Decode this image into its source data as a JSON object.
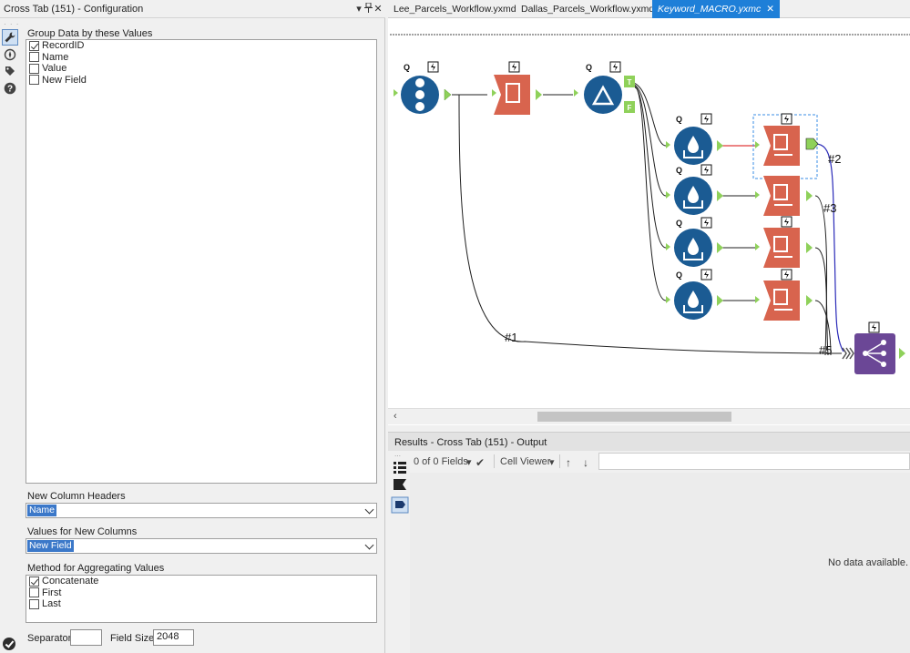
{
  "config_panel": {
    "title": "Cross Tab (151) - Configuration",
    "pin_label": "▾",
    "group_label": "Group Data by these Values",
    "group_fields": [
      {
        "label": "RecordID",
        "checked": true
      },
      {
        "label": "Name",
        "checked": false
      },
      {
        "label": "Value",
        "checked": false
      },
      {
        "label": "New Field",
        "checked": false
      }
    ],
    "headers_label": "New Column Headers",
    "headers_value": "Name",
    "values_label": "Values for New Columns",
    "values_value": "New Field",
    "method_label": "Method for Aggregating Values",
    "methods": [
      {
        "label": "Concatenate",
        "checked": true
      },
      {
        "label": "First",
        "checked": false
      },
      {
        "label": "Last",
        "checked": false
      }
    ],
    "separator_label": "Separator:",
    "separator_value": "",
    "field_size_label": "Field Size:",
    "field_size_value": "2048"
  },
  "tabs": [
    {
      "label": "Lee_Parcels_Workflow.yxmd",
      "active": false
    },
    {
      "label": "Dallas_Parcels_Workflow.yxmd",
      "active": false
    },
    {
      "label": "Keyword_MACRO.yxmc",
      "active": true
    }
  ],
  "canvas": {
    "connection_labels": [
      "#1",
      "#2",
      "#3",
      "#5"
    ],
    "tool_badges": {
      "q": "Q",
      "t": "T",
      "f": "F"
    },
    "colors": {
      "blue_tool": "#1b5b93",
      "orange_tool": "#d8644e",
      "purple_tool": "#6b4796",
      "anchor": "#8fd15a",
      "selection": "#3a8ee6"
    }
  },
  "results": {
    "title": "Results - Cross Tab (151) - Output",
    "fields_label": "0 of 0 Fields",
    "viewer_label": "Cell Viewer",
    "no_data": "No data available. (Us"
  }
}
